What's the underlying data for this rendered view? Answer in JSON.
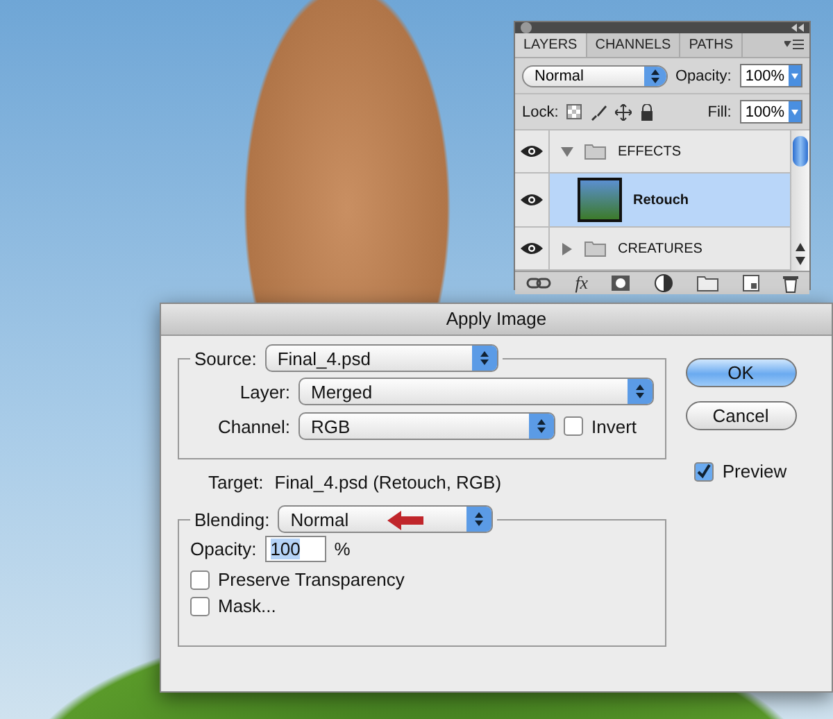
{
  "layers_panel": {
    "tabs": [
      {
        "label": "LAYERS",
        "selected": true
      },
      {
        "label": "CHANNELS",
        "selected": false
      },
      {
        "label": "PATHS",
        "selected": false
      }
    ],
    "blend_mode": "Normal",
    "opacity_label": "Opacity:",
    "opacity": "100%",
    "lock_label": "Lock:",
    "fill_label": "Fill:",
    "fill": "100%",
    "layers": [
      {
        "kind": "group",
        "name": "EFFECTS",
        "visible": true,
        "expanded": true,
        "selected": false,
        "children": [
          {
            "kind": "layer",
            "name": "Retouch",
            "visible": true,
            "selected": true
          }
        ]
      },
      {
        "kind": "group",
        "name": "CREATURES",
        "visible": true,
        "expanded": false,
        "selected": false
      }
    ],
    "style_button": "fx"
  },
  "dialog": {
    "title": "Apply Image",
    "source_label": "Source:",
    "source": "Final_4.psd",
    "layer_label": "Layer:",
    "layer": "Merged",
    "channel_label": "Channel:",
    "channel": "RGB",
    "invert": {
      "label": "Invert",
      "checked": false
    },
    "target_label": "Target:",
    "target": "Final_4.psd (Retouch, RGB)",
    "blending_label": "Blending:",
    "blending": "Normal",
    "opacity_label": "Opacity:",
    "opacity": "100",
    "percent": "%",
    "options": [
      {
        "label": "Preserve Transparency",
        "checked": false
      },
      {
        "label": "Mask...",
        "checked": false
      }
    ],
    "buttons": [
      {
        "label": "OK",
        "kind": "default"
      },
      {
        "label": "Cancel",
        "kind": "normal"
      }
    ],
    "preview": {
      "label": "Preview",
      "checked": true
    }
  }
}
